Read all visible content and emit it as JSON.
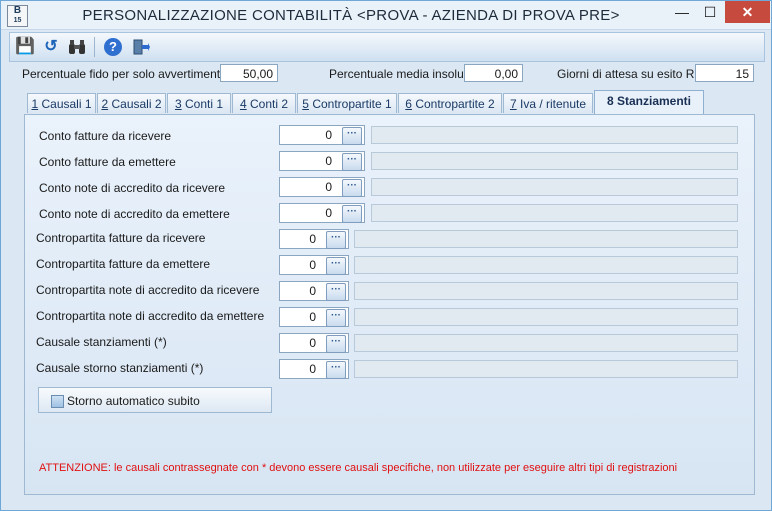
{
  "window": {
    "title": "PERSONALIZZAZIONE CONTABILITÀ <PROVA - AZIENDA DI PROVA PRE>",
    "icon_text": "B",
    "icon_sub": "15",
    "min_symbol": "—",
    "max_symbol": "☐",
    "close_symbol": "✕"
  },
  "toolbar": {
    "save_icon": "save-icon",
    "undo_icon": "undo-icon",
    "find_icon": "binoculars-icon",
    "help_icon": "help-icon",
    "exit_icon": "exit-icon",
    "save_glyph": "💾",
    "undo_glyph": "↺",
    "find_glyph": "⛭",
    "help_glyph": "?",
    "exit_glyph": "⇥"
  },
  "header": {
    "fido_label": "Percentuale fido per solo avvertimento",
    "fido_value": "50,00",
    "insoluti_label": "Percentuale media insoluti",
    "insoluti_value": "0,00",
    "giorni_label": "Giorni di attesa su esito RB",
    "giorni_value": "15"
  },
  "tabs": [
    {
      "key": "1",
      "label": " Causali 1"
    },
    {
      "key": "2",
      "label": " Causali 2"
    },
    {
      "key": "3",
      "label": " Conti 1"
    },
    {
      "key": "4",
      "label": " Conti 2"
    },
    {
      "key": "5",
      "label": " Contropartite 1"
    },
    {
      "key": "6",
      "label": " Contropartite 2"
    },
    {
      "key": "7",
      "label": " Iva / ritenute"
    },
    {
      "key": "8",
      "label": " Stanziamenti",
      "active": true
    }
  ],
  "fields": [
    {
      "label": "Conto fatture da ricevere",
      "value": "0"
    },
    {
      "label": "Conto fatture da emettere",
      "value": "0"
    },
    {
      "label": "Conto note di accredito da ricevere",
      "value": "0"
    },
    {
      "label": "Conto note di accredito da emettere",
      "value": "0"
    },
    {
      "label": "Contropartita fatture da ricevere",
      "value": "0"
    },
    {
      "label": "Contropartita fatture da emettere",
      "value": "0"
    },
    {
      "label": "Contropartita note di accredito da ricevere",
      "value": "0"
    },
    {
      "label": "Contropartita note di accredito da emettere",
      "value": "0"
    },
    {
      "label": "Causale stanziamenti (*)",
      "value": "0"
    },
    {
      "label": "Causale storno stanziamenti (*)",
      "value": "0"
    }
  ],
  "lookup_glyph": "···",
  "checkbox": {
    "label": "Storno automatico subito",
    "checked": false
  },
  "warning": "ATTENZIONE: le causali contrassegnate con * devono essere causali specifiche, non utilizzate per eseguire altri tipi di registrazioni",
  "colors": {
    "warning": "#e01010",
    "accent": "#2f6fd0"
  }
}
